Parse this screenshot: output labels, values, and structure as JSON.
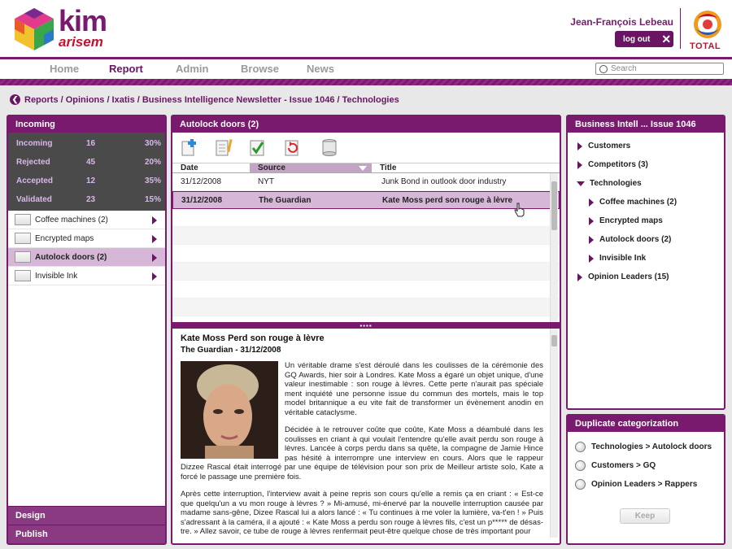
{
  "header": {
    "brand_main": "kim",
    "brand_sub": "arisem",
    "user_name": "Jean-François Lebeau",
    "logout_label": "log out",
    "partner_logo_text": "TOTAL"
  },
  "nav": {
    "tabs": [
      "Home",
      "Report",
      "Admin",
      "Browse",
      "News"
    ],
    "active_tab": "Report",
    "search_placeholder": "Search"
  },
  "breadcrumb": "Reports / Opinions / Ixatis / Business Intelligence Newsletter - Issue 1046 / Technologies",
  "left_panel": {
    "title": "Incoming",
    "stats": [
      {
        "label": "Incoming",
        "count": "16",
        "percent": "30%"
      },
      {
        "label": "Rejected",
        "count": "45",
        "percent": "20%"
      },
      {
        "label": "Accepted",
        "count": "12",
        "percent": "35%"
      },
      {
        "label": "Validated",
        "count": "23",
        "percent": "15%"
      }
    ],
    "folders": [
      {
        "label": "Coffee machines (2)",
        "selected": false
      },
      {
        "label": "Encrypted maps",
        "selected": false
      },
      {
        "label": "Autolock doors (2)",
        "selected": true
      },
      {
        "label": "Invisible Ink",
        "selected": false
      }
    ],
    "footer": [
      "Design",
      "Publish"
    ]
  },
  "center_panel": {
    "title": "Autolock doors (2)",
    "toolbar_icons": [
      "add-document-icon",
      "edit-document-icon",
      "validate-check-icon",
      "refresh-icon",
      "archive-icon"
    ],
    "columns": [
      "Date",
      "Source",
      "Title"
    ],
    "rows": [
      {
        "date": "31/12/2008",
        "source": "NYT",
        "title": "Junk Bond in outlook door industry",
        "selected": false
      },
      {
        "date": "31/12/2008",
        "source": "The Guardian",
        "title": "Kate Moss perd son rouge à lèvre",
        "selected": true
      }
    ],
    "article": {
      "title": "Kate Moss Perd son rouge à lèvre",
      "byline": "The Guardian - 31/12/2008",
      "paragraphs": [
        "Un véritable drame s'est déroulé dans les coulisses de la cérémonie des GQ Awards, hier soir à Londres. Kate Moss a égaré un objet unique, d'une valeur inestimable : son rouge à lèvres. Cette perte n'aurait pas spéciale ment inquiété une personne issue du commun des mortels, mais le top model britannique a eu vite fait de transformer un évènement anodin en véritable cataclysme.",
        "Décidée à le retrouver coûte que coûte, Kate Moss a déambulé dans les coulisses en criant à qui voulait l'entendre qu'elle avait perdu son rouge à lèvres. Lancée à corps perdu dans sa quête, la compagne de Jamie Hince pas hésité à interrompre une interview en cours. Alors que le rappeur Dizzee Rascal était interrogé par une équipe de télévision pour son prix de Meilleur artiste solo, Kate a forcé le passage une première fois.",
        "Après cette interruption, l'interview avait à peine repris son cours qu'elle a remis ça en criant : « Est-ce que quelqu'un a vu mon rouge à lèvres ? » Mi-amusé, mi-énervé par la nouvelle interruption causée par madame sans-gêne, Dizee Rascal lui a alors lancé : « Tu continues à me voler la lumière, va-t'en ! » Puis s'adressant à la caméra, il a ajouté : « Kate Moss a perdu son rouge à lèvres fils, c'est un p***** de désas- tre. » Allez savoir, ce tube de rouge à lèvres renfermait peut-être quelque chose de très important pour"
      ]
    }
  },
  "right_panel": {
    "title": "Business Intell ... Issue 1046",
    "tree": [
      {
        "label": "Customers",
        "level": 0,
        "expanded": false
      },
      {
        "label": "Competitors (3)",
        "level": 0,
        "expanded": false
      },
      {
        "label": "Technologies",
        "level": 0,
        "expanded": true
      },
      {
        "label": "Coffee machines (2)",
        "level": 1,
        "expanded": false
      },
      {
        "label": "Encrypted maps",
        "level": 1,
        "expanded": false
      },
      {
        "label": "Autolock doors (2)",
        "level": 1,
        "expanded": false
      },
      {
        "label": "Invisible Ink",
        "level": 1,
        "expanded": false
      },
      {
        "label": "Opinion Leaders (15)",
        "level": 0,
        "expanded": false
      }
    ]
  },
  "duplicate_panel": {
    "title": "Duplicate categorization",
    "options": [
      "Technologies > Autolock doors",
      "Customers > GQ",
      "Opinion Leaders > Rappers"
    ],
    "keep_label": "Keep"
  },
  "colors": {
    "brand_purple": "#7a1a6e",
    "selection": "#d7b7d7",
    "stats_bg": "#4a4a4a",
    "total_red": "#c8102e"
  }
}
